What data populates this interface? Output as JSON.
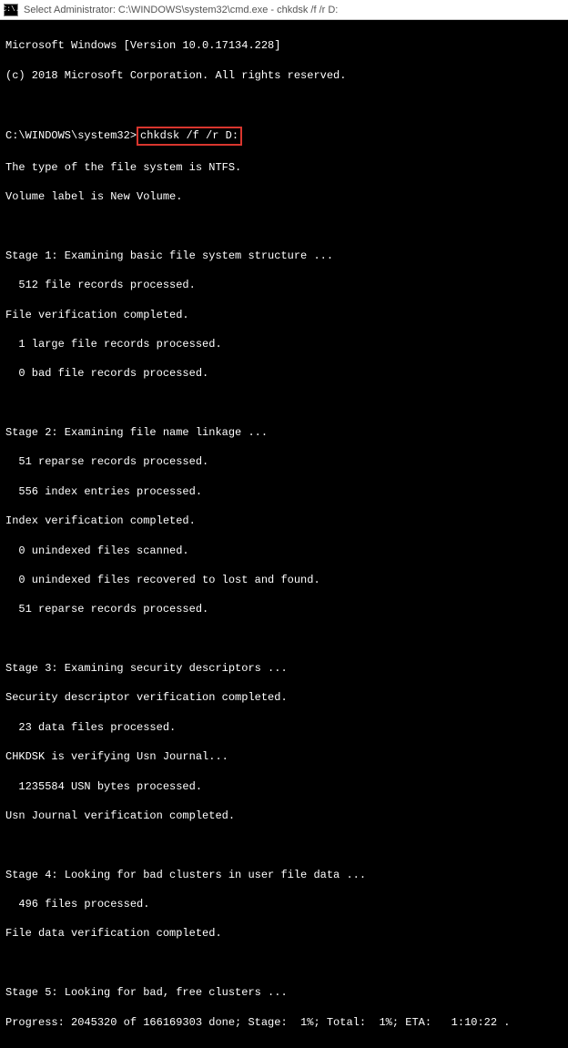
{
  "titlebar": {
    "icon_text": "C:\\.",
    "title": "Select Administrator: C:\\WINDOWS\\system32\\cmd.exe - chkdsk  /f /r D:"
  },
  "header": {
    "line1": "Microsoft Windows [Version 10.0.17134.228]",
    "line2": "(c) 2018 Microsoft Corporation. All rights reserved."
  },
  "prompt": {
    "path": "C:\\WINDOWS\\system32>",
    "command": "chkdsk /f /r D:"
  },
  "intro": {
    "line1": "The type of the file system is NTFS.",
    "line2": "Volume label is New Volume."
  },
  "stage1": {
    "title": "Stage 1: Examining basic file system structure ...",
    "l1": "  512 file records processed.",
    "l2": "File verification completed.",
    "l3": "  1 large file records processed.",
    "l4": "  0 bad file records processed."
  },
  "stage2": {
    "title": "Stage 2: Examining file name linkage ...",
    "l1": "  51 reparse records processed.",
    "l2": "  556 index entries processed.",
    "l3": "Index verification completed.",
    "l4": "  0 unindexed files scanned.",
    "l5": "  0 unindexed files recovered to lost and found.",
    "l6": "  51 reparse records processed."
  },
  "stage3": {
    "title": "Stage 3: Examining security descriptors ...",
    "l1": "Security descriptor verification completed.",
    "l2": "  23 data files processed.",
    "l3": "CHKDSK is verifying Usn Journal...",
    "l4": "  1235584 USN bytes processed.",
    "l5": "Usn Journal verification completed."
  },
  "stage4": {
    "title": "Stage 4: Looking for bad clusters in user file data ...",
    "l1": "  496 files processed.",
    "l2": "File data verification completed."
  },
  "stage5": {
    "title": "Stage 5: Looking for bad, free clusters ...",
    "progress": "Progress: 2045320 of 166169303 done; Stage:  1%; Total:  1%; ETA:   1:10:22 ."
  }
}
